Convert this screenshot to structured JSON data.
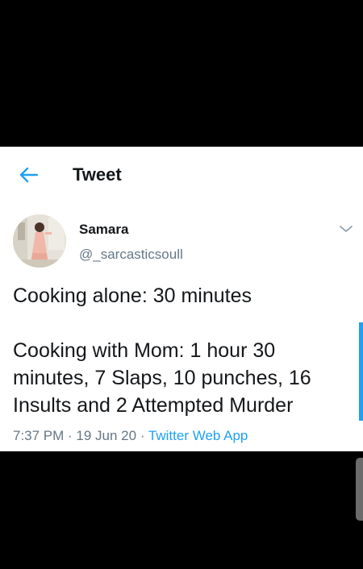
{
  "header": {
    "title": "Tweet"
  },
  "user": {
    "name": "Samara",
    "handle": "@_sarcasticsoull"
  },
  "tweet": {
    "text": "Cooking alone: 30 minutes\n\nCooking with Mom: 1 hour 30\nminutes, 7 Slaps, 10 punches, 16\nInsults and 2 Attempted Murder"
  },
  "meta": {
    "time": "7:37 PM",
    "sep1": " · ",
    "date": "19 Jun 20",
    "sep2": " · ",
    "source": "Twitter Web App"
  },
  "colors": {
    "accent": "#1da1f2",
    "secondary_text": "#657786",
    "primary_text": "#14171a",
    "background": "#000000",
    "card": "#ffffff"
  },
  "icons": {
    "back": "arrow-left-icon",
    "more": "chevron-down-icon"
  }
}
